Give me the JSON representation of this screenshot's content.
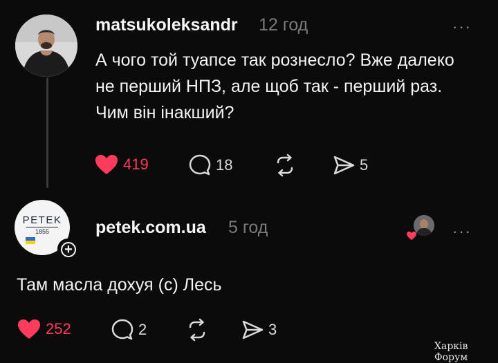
{
  "post1": {
    "username": "matsukoleksandr",
    "time": "12 год",
    "more": "···",
    "text": "А чого той туапсе так рознесло? Вже далеко не перший НПЗ, але щоб так - перший раз. Чим він інакший?",
    "actions": {
      "likes": "419",
      "comments": "18",
      "shares": "5"
    }
  },
  "post2": {
    "username": "petek.com.ua",
    "time": "5 год",
    "more": "···",
    "avatar_logo": {
      "name": "PETEK",
      "year": "1855"
    },
    "follow_symbol": "+",
    "text": "Там масла дохуя (с) Лесь",
    "actions": {
      "likes": "252",
      "comments": "2",
      "shares": "3"
    }
  },
  "watermark": "Харків Форум",
  "colors": {
    "background": "#0b0b0b",
    "like": "#ff3b5c",
    "muted": "#7a7a7a",
    "text": "#f3f3f3"
  }
}
